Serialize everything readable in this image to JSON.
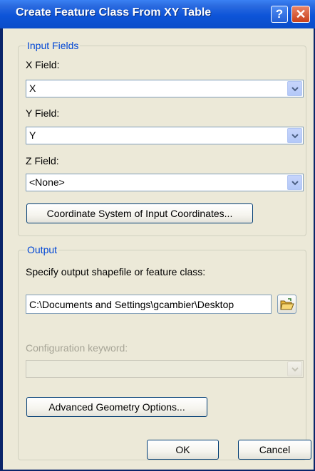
{
  "window": {
    "title": "Create Feature Class From XY Table",
    "help_glyph": "?",
    "close_glyph": "✕"
  },
  "input_fields": {
    "legend": "Input Fields",
    "x_label": "X Field:",
    "x_value": "X",
    "y_label": "Y Field:",
    "y_value": "Y",
    "z_label": "Z Field:",
    "z_value": "<None>",
    "coord_button": "Coordinate System of Input Coordinates..."
  },
  "output": {
    "legend": "Output",
    "specify_label": "Specify output shapefile or feature class:",
    "path_value": "C:\\Documents and Settings\\gcambier\\Desktop",
    "folder_icon": "open-folder-icon",
    "config_label": "Configuration keyword:",
    "config_value": "",
    "advanced_button": "Advanced Geometry Options..."
  },
  "footer": {
    "ok_label": "OK",
    "cancel_label": "Cancel"
  },
  "colors": {
    "title_bar": "#0d54d8",
    "legend_text": "#0046d5",
    "dialog_bg": "#ece9d8",
    "close_button": "#c9401a",
    "help_button": "#2460d6"
  }
}
